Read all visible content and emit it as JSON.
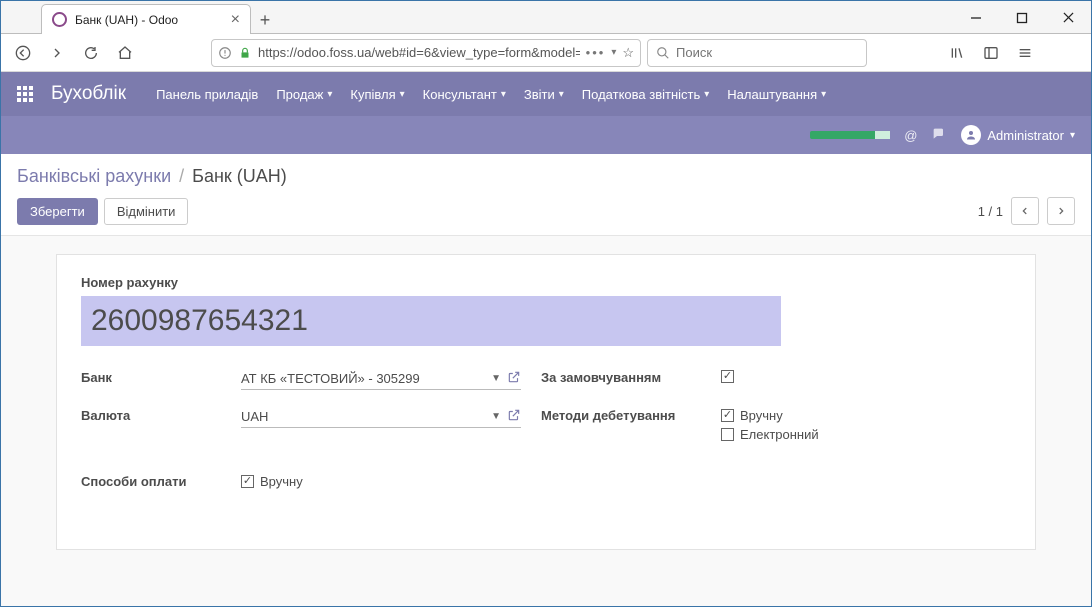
{
  "browser": {
    "tab_title": "Банк (UAH) - Odoo",
    "url": "https://odoo.foss.ua/web#id=6&view_type=form&model=",
    "search_placeholder": "Поиск"
  },
  "nav": {
    "brand": "Бухоблік",
    "menus": {
      "dashboard": "Панель приладів",
      "sales": "Продаж",
      "purchase": "Купівля",
      "advisor": "Консультант",
      "reports": "Звіти",
      "tax_reports": "Податкова звітність",
      "config": "Налаштування"
    },
    "user": "Administrator"
  },
  "control_panel": {
    "breadcrumb_root": "Банківські рахунки",
    "breadcrumb_current": "Банк (UAH)",
    "save": "Зберегти",
    "discard": "Відмінити",
    "pager": "1 / 1"
  },
  "form": {
    "acc_number_label": "Номер рахунку",
    "acc_number": "2600987654321",
    "bank_label": "Банк",
    "bank_value": "АТ КБ «ТЕСТОВИЙ» - 305299",
    "currency_label": "Валюта",
    "currency_value": "UAH",
    "outbound_label": "Способи оплати",
    "outbound_manual": "Вручну",
    "default_label": "За замовчуванням",
    "debit_methods_label": "Методи дебетування",
    "debit_manual": "Вручну",
    "debit_electronic": "Електронний"
  }
}
